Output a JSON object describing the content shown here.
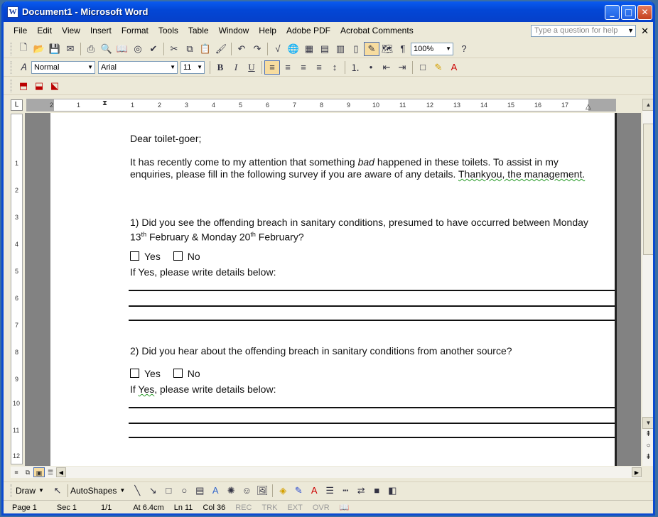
{
  "window": {
    "title": "Document1 - Microsoft Word"
  },
  "menu": [
    "File",
    "Edit",
    "View",
    "Insert",
    "Format",
    "Tools",
    "Table",
    "Window",
    "Help",
    "Adobe PDF",
    "Acrobat Comments"
  ],
  "help_box": {
    "placeholder": "Type a question for help"
  },
  "toolbar": {
    "zoom": "100%",
    "style": "Normal",
    "font": "Arial",
    "size": "11"
  },
  "ruler": {
    "h_numbers": [
      "2",
      "1",
      "1",
      "2",
      "3",
      "4",
      "5",
      "6",
      "7",
      "8",
      "9",
      "10",
      "11",
      "12",
      "13",
      "14",
      "15",
      "16",
      "17"
    ],
    "v_numbers": [
      "1",
      "2",
      "3",
      "4",
      "5",
      "6",
      "7",
      "8",
      "9",
      "10",
      "11",
      "12"
    ]
  },
  "document": {
    "greeting": "Dear toilet-goer;",
    "intro_1a": "It has recently come to my attention that something ",
    "intro_1b": "bad",
    "intro_1c": " happened in these toilets.  To assist in my",
    "intro_2a": "enquiries, please fill in the following survey if you are aware of any details.   ",
    "intro_2b": "Thankyou, the management.",
    "q1_line1": "1)  Did you see the offending breach in sanitary conditions, presumed to have occurred between Monday",
    "q1_line2a": "13",
    "q1_line2_sup1": "th",
    "q1_line2b": " February & Monday 20",
    "q1_line2_sup2": "th",
    "q1_line2c": " February?",
    "yes": "Yes",
    "no": "No",
    "if_yes_1": "If Yes, please write details below:",
    "q2_line1": "2) Did you hear about the offending breach in sanitary conditions from another source?",
    "if_yes_2a": "If ",
    "if_yes_2b": "Yes",
    "if_yes_2c": ", please write details below:"
  },
  "drawbar": {
    "draw": "Draw",
    "autoshapes": "AutoShapes"
  },
  "status": {
    "page": "Page 1",
    "sec": "Sec 1",
    "pages": "1/1",
    "at": "At 6.4cm",
    "ln": "Ln 11",
    "col": "Col 36",
    "rec": "REC",
    "trk": "TRK",
    "ext": "EXT",
    "ovr": "OVR"
  }
}
